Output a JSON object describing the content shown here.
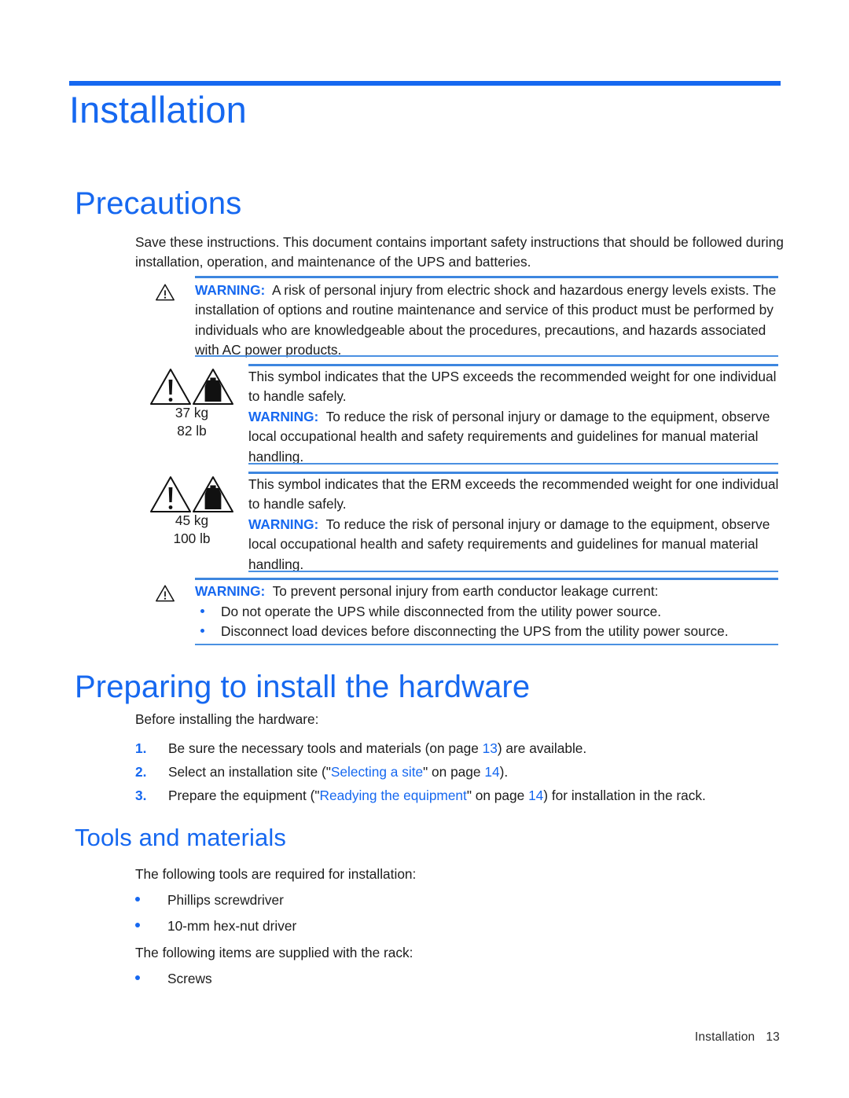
{
  "theme": {
    "accent_blue": "#1668f0",
    "rule_blue": "#4a90e2",
    "body_black": "#1c1c1c"
  },
  "chapter": {
    "title": "Installation"
  },
  "sections": {
    "precautions": {
      "heading": "Precautions",
      "intro_line1": "Save these instructions. This document contains important safety instructions that should be followed during",
      "intro_line2": "installation, operation, and maintenance of the UPS and batteries."
    },
    "preparing": {
      "heading": "Preparing to install the hardware",
      "intro": "Before installing the hardware:"
    },
    "tools": {
      "heading": "Tools and materials",
      "intro_tools": "The following tools are required for installation:",
      "intro_supplied": "The following items are supplied with the rack:"
    }
  },
  "admonitions": [
    {
      "id": "electric-shock",
      "icon": "warning-triangle-icon",
      "label": "WARNING:",
      "lines": [
        "A risk of personal injury from electric shock and hazardous energy levels exists. The",
        "installation of options and routine maintenance and service of this product must be performed by",
        "individuals who are knowledgeable about the procedures, precautions, and hazards associated",
        "with AC power products."
      ]
    },
    {
      "id": "ups-weight",
      "icon": "weight-warning-icon",
      "weight_kg": "37 kg",
      "weight_lb": "82 lb",
      "symbol_lines": [
        "This symbol indicates that the UPS exceeds the recommended weight for one individual",
        "to handle safely."
      ],
      "label": "WARNING:",
      "lines": [
        "To reduce the risk of personal injury or damage to the equipment, observe",
        "local occupational health and safety requirements and guidelines for manual material",
        "handling."
      ]
    },
    {
      "id": "erm-weight",
      "icon": "weight-warning-icon",
      "weight_kg": "45 kg",
      "weight_lb": "100 lb",
      "symbol_lines": [
        "This symbol indicates that the ERM exceeds the recommended weight for one individual",
        "to handle safely."
      ],
      "label": "WARNING:",
      "lines": [
        "To reduce the risk of personal injury or damage to the equipment, observe",
        "local occupational health and safety requirements and guidelines for manual material",
        "handling."
      ]
    },
    {
      "id": "earth-leakage",
      "icon": "warning-triangle-icon",
      "label": "WARNING:",
      "lines": [
        "To prevent personal injury from earth conductor leakage current:"
      ],
      "bullets": [
        "Do not operate the UPS while disconnected from the utility power source.",
        "Disconnect load devices before disconnecting the UPS from the utility power source."
      ]
    }
  ],
  "numbered_steps": [
    {
      "number": "1.",
      "parts": [
        {
          "text": "Be sure the necessary tools and materials (on page ",
          "link": false
        },
        {
          "text": "13",
          "link": true
        },
        {
          "text": ") are available.",
          "link": false
        }
      ]
    },
    {
      "number": "2.",
      "parts": [
        {
          "text": "Select an installation site (\"",
          "link": false
        },
        {
          "text": "Selecting a site",
          "link": true
        },
        {
          "text": "\" on page ",
          "link": false
        },
        {
          "text": "14",
          "link": true
        },
        {
          "text": ").",
          "link": false
        }
      ]
    },
    {
      "number": "3.",
      "parts": [
        {
          "text": "Prepare the equipment (\"",
          "link": false
        },
        {
          "text": "Readying the equipment",
          "link": true
        },
        {
          "text": "\" on page ",
          "link": false
        },
        {
          "text": "14",
          "link": true
        },
        {
          "text": ") for installation in the rack.",
          "link": false
        }
      ]
    }
  ],
  "tool_bullets": [
    "Phillips screwdriver",
    "10-mm hex-nut driver"
  ],
  "supplied_bullets": [
    "Screws"
  ],
  "footer": {
    "chapter_name": "Installation",
    "page_number": "13"
  }
}
